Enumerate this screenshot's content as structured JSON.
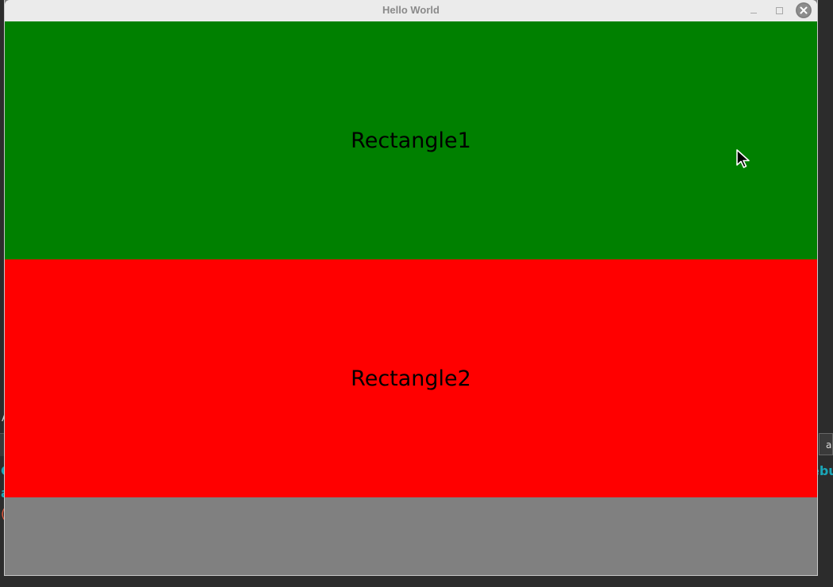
{
  "window": {
    "title": "Hello World"
  },
  "rectangles": [
    {
      "label": "Rectangle1",
      "color": "#008000"
    },
    {
      "label": "Rectangle2",
      "color": "#ff0000"
    }
  ],
  "background_fragments": {
    "a": "A",
    "tab_right": "a",
    "teal1": "C",
    "teal2": "a",
    "red": "(",
    "teal_right": "ebu"
  },
  "colors": {
    "window_fill": "#808080",
    "titlebar": "#ebebeb"
  }
}
